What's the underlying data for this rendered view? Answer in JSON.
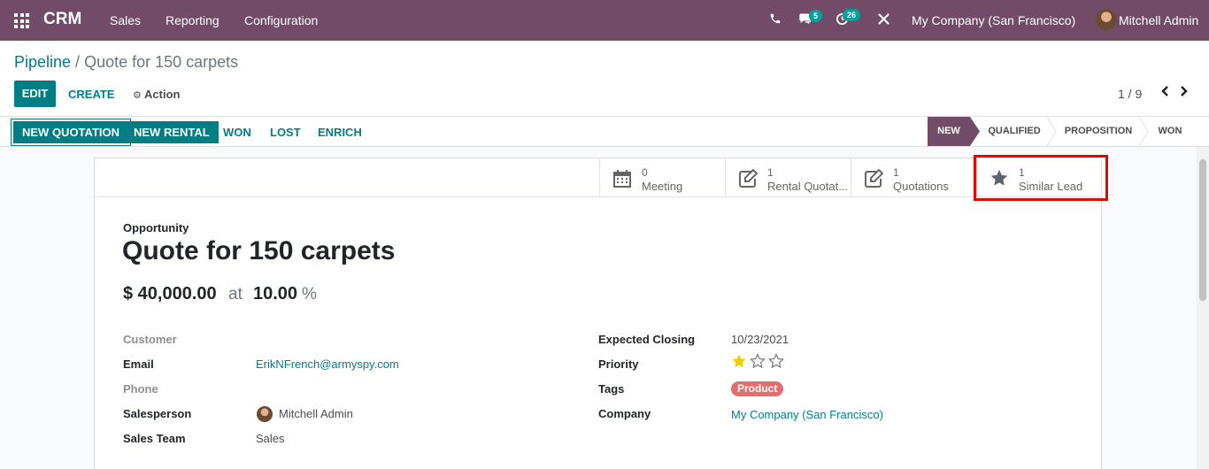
{
  "navbar": {
    "brand": "CRM",
    "menu": [
      "Sales",
      "Reporting",
      "Configuration"
    ],
    "messages_badge": "5",
    "activities_badge": "26",
    "company": "My Company (San Francisco)",
    "user": "Mitchell Admin",
    "icons": [
      "apps-grid-icon",
      "phone-icon",
      "chat-icon",
      "clock-icon",
      "tools-icon"
    ]
  },
  "breadcrumb": {
    "parent": "Pipeline",
    "separator": " / ",
    "current": "Quote for 150 carpets"
  },
  "actions": {
    "edit": "EDIT",
    "create": "CREATE",
    "action": "Action"
  },
  "pager": {
    "value": "1 / 9"
  },
  "statusbar": {
    "buttons": [
      "NEW QUOTATION",
      "NEW RENTAL",
      "WON",
      "LOST",
      "ENRICH"
    ],
    "stages": [
      "NEW",
      "QUALIFIED",
      "PROPOSITION",
      "WON"
    ],
    "active_stage": "NEW"
  },
  "smart_buttons": [
    {
      "value": "0",
      "label": "Meeting",
      "icon": "calendar-icon"
    },
    {
      "value": "1",
      "label": "Rental Quotat...",
      "icon": "edit-icon"
    },
    {
      "value": "1",
      "label": "Quotations",
      "icon": "edit-icon"
    },
    {
      "value": "1",
      "label": "Similar Lead",
      "icon": "star-icon"
    }
  ],
  "record": {
    "type_label": "Opportunity",
    "title": "Quote for 150 carpets",
    "revenue": "$ 40,000.00",
    "at": "at",
    "probability": "10.00",
    "percent": "%"
  },
  "fields_left": {
    "customer_label": "Customer",
    "email_label": "Email",
    "email": "ErikNFrench@armyspy.com",
    "phone_label": "Phone",
    "salesperson_label": "Salesperson",
    "salesperson": "Mitchell Admin",
    "team_label": "Sales Team",
    "team": "Sales"
  },
  "fields_right": {
    "closing_label": "Expected Closing",
    "closing": "10/23/2021",
    "priority_label": "Priority",
    "priority_stars": 1,
    "priority_max": 3,
    "tags_label": "Tags",
    "tag": "Product",
    "company_label": "Company",
    "company": "My Company (San Francisco)"
  },
  "colors": {
    "brand": "#714b67",
    "accent": "#017e84",
    "tag": "#e46e6e",
    "star": "#f3cc00",
    "highlight": "#e10600"
  }
}
